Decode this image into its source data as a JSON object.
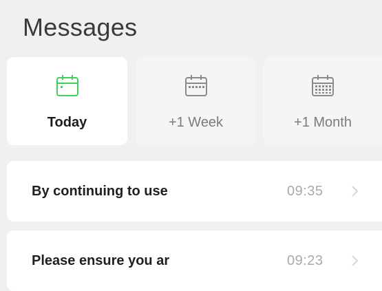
{
  "header": {
    "title": "Messages"
  },
  "tabs": [
    {
      "label": "Today",
      "icon": "calendar-today-icon",
      "active": true
    },
    {
      "label": "+1 Week",
      "icon": "calendar-week-icon",
      "active": false
    },
    {
      "label": "+1 Month",
      "icon": "calendar-month-icon",
      "active": false
    }
  ],
  "messages": [
    {
      "text": "By continuing to use",
      "time": "09:35",
      "icon": "chevron-right-icon"
    },
    {
      "text": "Please ensure you ar",
      "time": "09:23",
      "icon": "chevron-right-icon"
    }
  ],
  "colors": {
    "background": "#f0f0f0",
    "card": "#ffffff",
    "tab_inactive": "#f5f5f5",
    "accent_green": "#3fcf5c",
    "icon_gray": "#8a8a8a",
    "time_gray": "#a9a9a9"
  }
}
